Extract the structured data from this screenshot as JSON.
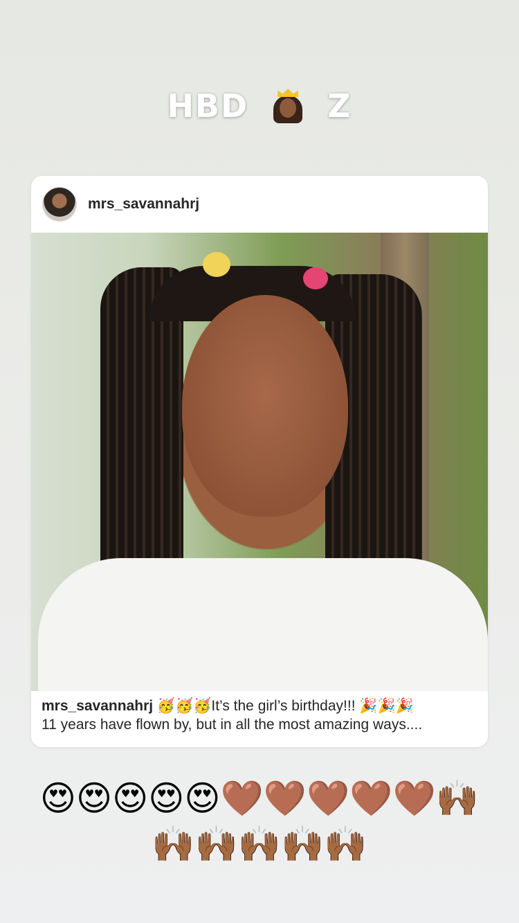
{
  "story": {
    "headline_left": "HBD",
    "headline_right": "Z",
    "headline_emoji": "princess-icon"
  },
  "post": {
    "username": "mrs_savannahrj",
    "caption_user": "mrs_savannahrj",
    "caption_line1": " 🥳🥳🥳It’s the girl’s birthday!!! 🎉🎉🎉",
    "caption_line2": "11 years have flown by, but in all the most amazing ways...."
  },
  "emoji_rows": {
    "row1": "😍😍😍😍😍🤎🤎🤎🤎🤎🙌🏾",
    "row2": "🙌🏾🙌🏾🙌🏾🙌🏾🙌🏾"
  }
}
